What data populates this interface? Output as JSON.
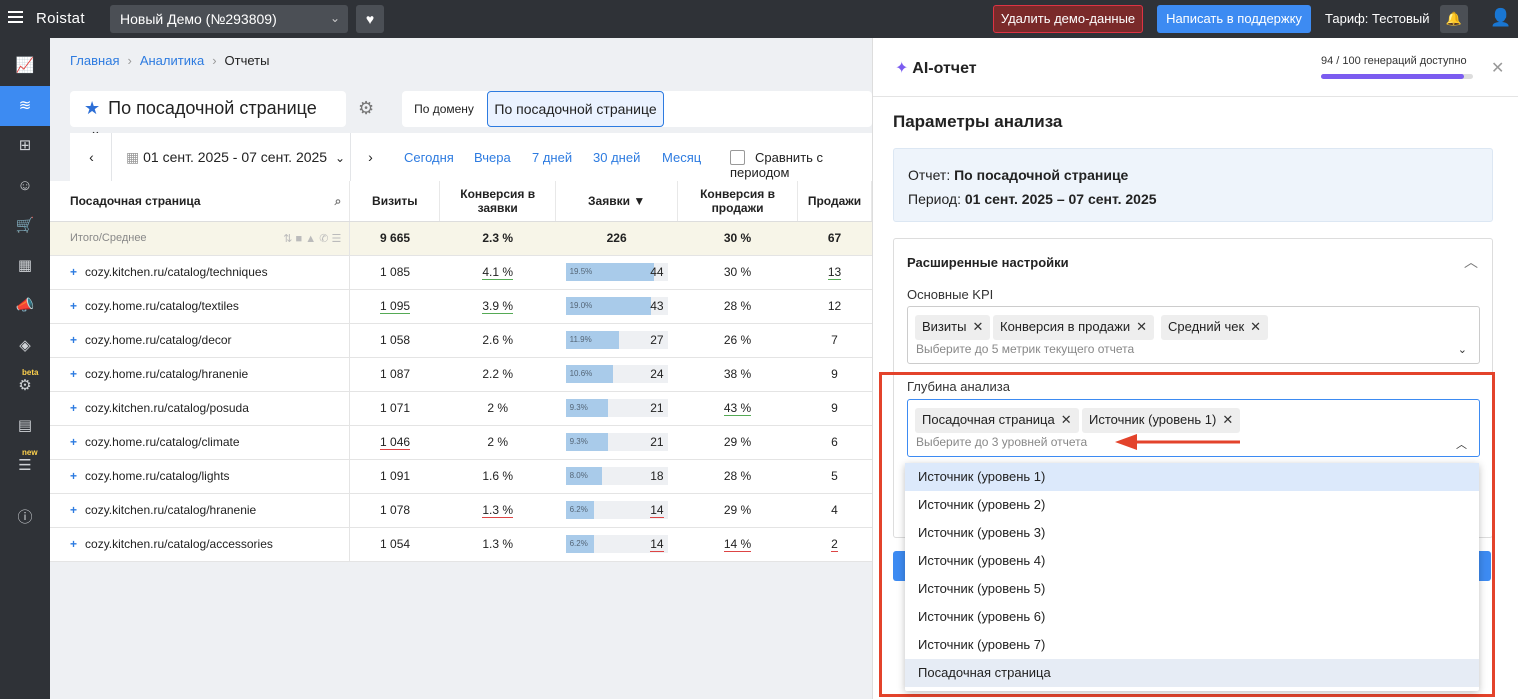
{
  "header": {
    "logo": "Roistat",
    "project": "Новый Демо (№293809)",
    "delete_demo": "Удалить демо-данные",
    "support": "Написать в поддержку",
    "tariff": "Тариф: Тестовый"
  },
  "sidebar": {
    "beta": "beta",
    "new": "new"
  },
  "breadcrumb": [
    "Главная",
    "Аналитика",
    "Отчеты"
  ],
  "report": {
    "name": "По посадочной странице",
    "tab_domain": "По домену",
    "tab_page": "По посадочной странице"
  },
  "dates": {
    "range": "01 сент. 2025 - 07 сент. 2025",
    "quick": [
      "Сегодня",
      "Вчера",
      "7 дней",
      "30 дней",
      "Месяц"
    ],
    "compare": "Сравнить с периодом"
  },
  "table": {
    "headers": {
      "page": "Посадочная страница",
      "visits": "Визиты",
      "conv_leads": "Конверсия в заявки",
      "leads": "Заявки ▼",
      "conv_sales": "Конверсия в продажи",
      "sales": "Продажи"
    },
    "total": {
      "label": "Итого/Среднее",
      "visits": "9 665",
      "conv_leads": "2.3 %",
      "leads": "226",
      "conv_sales": "30 %",
      "sales": "67"
    },
    "rows": [
      {
        "page": "cozy.kitchen.ru/catalog/techniques",
        "visits": "1 085",
        "conv_leads": "4.1 %",
        "share": "19.5%",
        "share_v": 19.5,
        "leads": "44",
        "conv_sales": "30 %",
        "sales": "13"
      },
      {
        "page": "cozy.home.ru/catalog/textiles",
        "visits": "1 095",
        "conv_leads": "3.9 %",
        "share": "19.0%",
        "share_v": 19.0,
        "leads": "43",
        "conv_sales": "28 %",
        "sales": "12"
      },
      {
        "page": "cozy.home.ru/catalog/decor",
        "visits": "1 058",
        "conv_leads": "2.6 %",
        "share": "11.9%",
        "share_v": 11.9,
        "leads": "27",
        "conv_sales": "26 %",
        "sales": "7"
      },
      {
        "page": "cozy.home.ru/catalog/hranenie",
        "visits": "1 087",
        "conv_leads": "2.2 %",
        "share": "10.6%",
        "share_v": 10.6,
        "leads": "24",
        "conv_sales": "38 %",
        "sales": "9"
      },
      {
        "page": "cozy.kitchen.ru/catalog/posuda",
        "visits": "1 071",
        "conv_leads": "2 %",
        "share": "9.3%",
        "share_v": 9.3,
        "leads": "21",
        "conv_sales": "43 %",
        "sales": "9"
      },
      {
        "page": "cozy.home.ru/catalog/climate",
        "visits": "1 046",
        "conv_leads": "2 %",
        "share": "9.3%",
        "share_v": 9.3,
        "leads": "21",
        "conv_sales": "29 %",
        "sales": "6"
      },
      {
        "page": "cozy.home.ru/catalog/lights",
        "visits": "1 091",
        "conv_leads": "1.6 %",
        "share": "8.0%",
        "share_v": 8.0,
        "leads": "18",
        "conv_sales": "28 %",
        "sales": "5"
      },
      {
        "page": "cozy.kitchen.ru/catalog/hranenie",
        "visits": "1 078",
        "conv_leads": "1.3 %",
        "share": "6.2%",
        "share_v": 6.2,
        "leads": "14",
        "conv_sales": "29 %",
        "sales": "4"
      },
      {
        "page": "cozy.kitchen.ru/catalog/accessories",
        "visits": "1 054",
        "conv_leads": "1.3 %",
        "share": "6.2%",
        "share_v": 6.2,
        "leads": "14",
        "conv_sales": "14 %",
        "sales": "2"
      }
    ]
  },
  "ai": {
    "title": "AI-отчет",
    "generations": "94 / 100 генераций доступно",
    "gen_used": 0.94,
    "params_title": "Параметры анализа",
    "info_report_label": "Отчет:",
    "info_report": "По посадочной странице",
    "info_period_label": "Период:",
    "info_period": "01 сент. 2025 – 07 сент. 2025",
    "ext_title": "Расширенные настройки",
    "kpi_label": "Основные KPI",
    "kpi_chips": [
      "Визиты",
      "Конверсия в продажи",
      "Средний чек"
    ],
    "kpi_ph": "Выберите до 5 метрик текущего отчета",
    "depth_label": "Глубина анализа",
    "depth_chips": [
      "Посадочная страница",
      "Источник (уровень 1)"
    ],
    "depth_ph": "Выберите до 3 уровней отчета",
    "options": [
      "Источник (уровень 1)",
      "Источник (уровень 2)",
      "Источник (уровень 3)",
      "Источник (уровень 4)",
      "Источник (уровень 5)",
      "Источник (уровень 6)",
      "Источник (уровень 7)",
      "Посадочная страница"
    ]
  },
  "colors": {
    "accent": "#3d8bf2",
    "highlight": "#e3432b",
    "ai": "#7b5cf0"
  }
}
